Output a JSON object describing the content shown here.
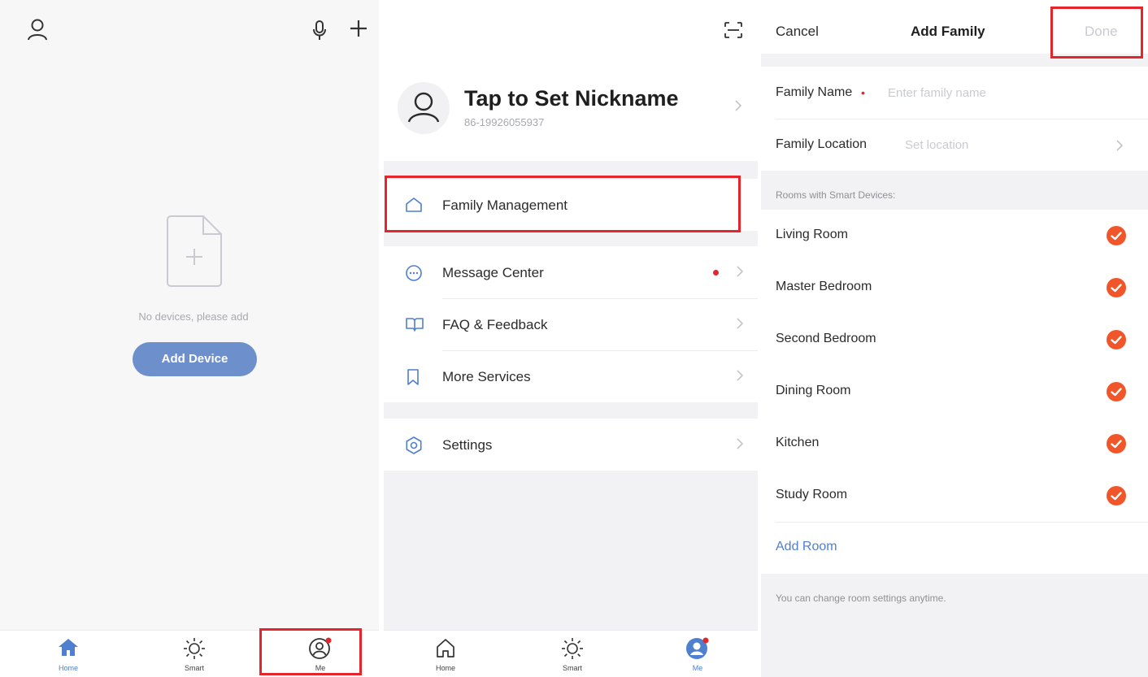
{
  "home_screen": {
    "empty_text": "No devices, please add",
    "add_device_label": "Add Device",
    "tabs": [
      {
        "label": "Home",
        "icon": "home-filled-icon",
        "active": true
      },
      {
        "label": "Smart",
        "icon": "sun-icon",
        "active": false
      },
      {
        "label": "Me",
        "icon": "user-circle-icon",
        "active": false
      }
    ]
  },
  "me_screen": {
    "nickname": "Tap to Set Nickname",
    "phone": "86-19926055937",
    "menu": {
      "family_management": "Family Management",
      "message_center": "Message Center",
      "faq_feedback": "FAQ & Feedback",
      "more_services": "More Services",
      "settings": "Settings"
    },
    "tabs": [
      {
        "label": "Home",
        "icon": "home-outline-icon",
        "active": false
      },
      {
        "label": "Smart",
        "icon": "sun-icon",
        "active": false
      },
      {
        "label": "Me",
        "icon": "user-filled-icon",
        "active": true
      }
    ]
  },
  "add_family_screen": {
    "cancel_label": "Cancel",
    "title": "Add Family",
    "done_label": "Done",
    "family_name_label": "Family Name",
    "family_name_placeholder": "Enter family name",
    "family_location_label": "Family Location",
    "family_location_placeholder": "Set location",
    "rooms_header": "Rooms with Smart Devices:",
    "rooms": [
      {
        "name": "Living Room",
        "checked": true
      },
      {
        "name": "Master Bedroom",
        "checked": true
      },
      {
        "name": "Second Bedroom",
        "checked": true
      },
      {
        "name": "Dining Room",
        "checked": true
      },
      {
        "name": "Kitchen",
        "checked": true
      },
      {
        "name": "Study Room",
        "checked": true
      }
    ],
    "add_room_label": "Add Room",
    "footer_note": "You can change room settings anytime."
  },
  "colors": {
    "accent_blue": "#4f7fcf",
    "button_blue": "#6d8fcb",
    "check_orange": "#f0562a",
    "highlight_red": "#e4262c",
    "notification_red": "#e4262c"
  }
}
